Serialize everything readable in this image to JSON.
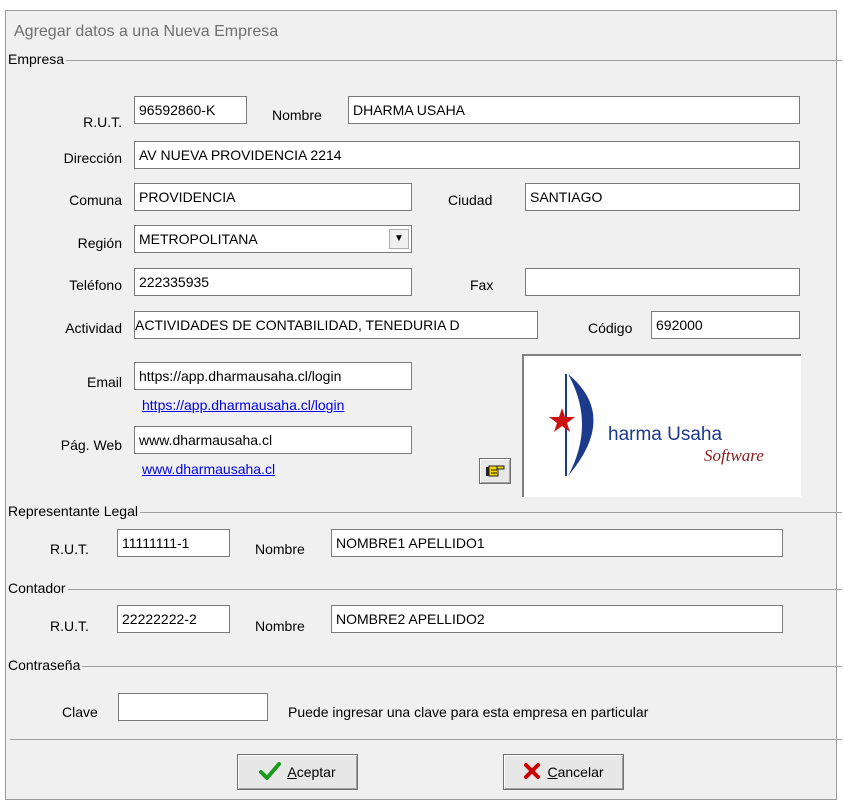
{
  "window": {
    "title": "Agregar datos a una Nueva Empresa"
  },
  "empresa": {
    "legend": "Empresa",
    "rut_label": "R.U.T.",
    "rut_value": "96592860-K",
    "nombre_label": "Nombre",
    "nombre_value": "DHARMA USAHA",
    "direccion_label": "Dirección",
    "direccion_value": "AV NUEVA PROVIDENCIA 2214",
    "comuna_label": "Comuna",
    "comuna_value": "PROVIDENCIA",
    "ciudad_label": "Ciudad",
    "ciudad_value": "SANTIAGO",
    "region_label": "Región",
    "region_value": "METROPOLITANA",
    "telefono_label": "Teléfono",
    "telefono_value": "222335935",
    "fax_label": "Fax",
    "fax_value": "",
    "actividad_label": "Actividad",
    "actividad_value": "ACTIVIDADES DE CONTABILIDAD, TENEDURIA D",
    "codigo_label": "Código",
    "codigo_value": "692000",
    "email_label": "Email",
    "email_value": "https://app.dharmausaha.cl/login",
    "email_link": "https://app.dharmausaha.cl/login",
    "web_label": "Pág. Web",
    "web_value": "www.dharmausaha.cl",
    "web_link": "www.dharmausaha.cl",
    "web_button_icon": "pointing-hand-icon",
    "logo_text": "harma Usaha",
    "logo_subtext": "Software"
  },
  "representante": {
    "legend": "Representante Legal",
    "rut_label": "R.U.T.",
    "rut_value": "11111111-1",
    "nombre_label": "Nombre",
    "nombre_value": "NOMBRE1 APELLIDO1"
  },
  "contador": {
    "legend": "Contador",
    "rut_label": "R.U.T.",
    "rut_value": "22222222-2",
    "nombre_label": "Nombre",
    "nombre_value": "NOMBRE2 APELLIDO2"
  },
  "contrasena": {
    "legend": "Contraseña",
    "clave_label": "Clave",
    "clave_value": "",
    "hint": "Puede ingresar una clave para esta empresa en particular"
  },
  "buttons": {
    "aceptar_mnemonic": "A",
    "aceptar_rest": "ceptar",
    "cancelar_mnemonic": "C",
    "cancelar_rest": "ancelar"
  },
  "colors": {
    "check": "#1a9a1a",
    "cross": "#cc0000",
    "logo_blue": "#1c3a8c",
    "logo_red": "#8b1a1a"
  }
}
